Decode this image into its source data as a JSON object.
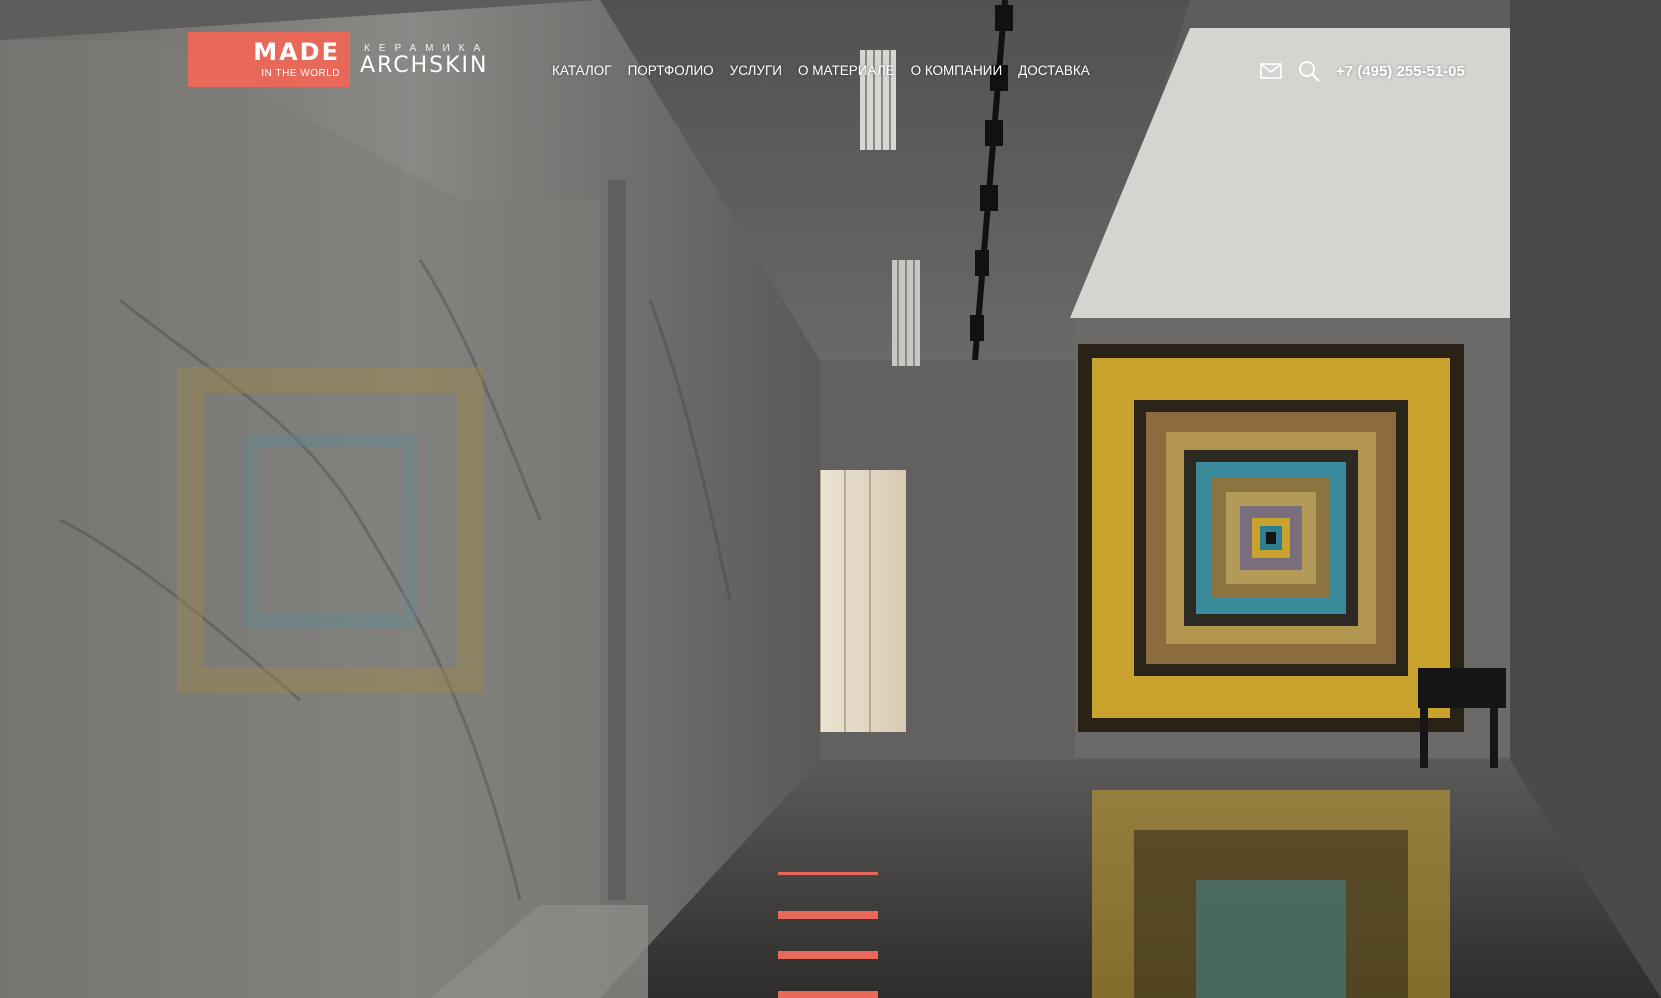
{
  "brand": {
    "logo_main": "MADE",
    "logo_sub": "IN THE WORLD",
    "tagline": "КЕРАМИКА",
    "name": "ARCHSKIN",
    "accent_color": "#e8695a"
  },
  "nav": {
    "items": [
      {
        "label": "КАТАЛОГ"
      },
      {
        "label": "ПОРТФОЛИО"
      },
      {
        "label": "УСЛУГИ"
      },
      {
        "label": "О МАТЕРИАЛЕ"
      },
      {
        "label": "О КОМПАНИИ"
      },
      {
        "label": "ДОСТАВКА"
      }
    ]
  },
  "header_tools": {
    "mail_icon": "mail-icon",
    "search_icon": "search-icon",
    "phone": "+7 (495) 255-51-05"
  },
  "hero": {
    "image_subject": "interior-gallery-photo"
  }
}
